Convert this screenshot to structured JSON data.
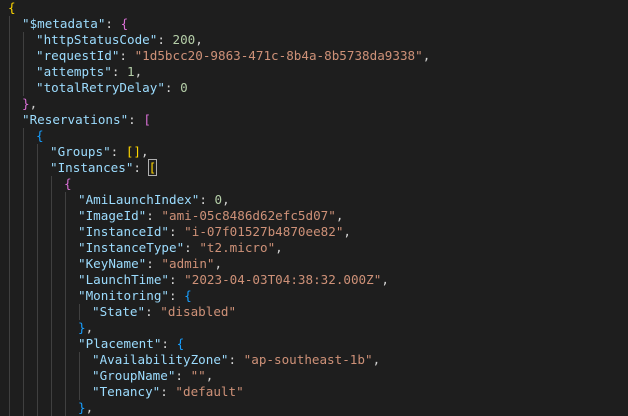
{
  "lines": [
    {
      "indent": 0,
      "tokens": [
        {
          "t": "{",
          "c": "b1"
        }
      ]
    },
    {
      "indent": 1,
      "tokens": [
        {
          "t": "\"$metadata\"",
          "c": "k"
        },
        {
          "t": ": ",
          "c": "p"
        },
        {
          "t": "{",
          "c": "b2"
        }
      ]
    },
    {
      "indent": 2,
      "tokens": [
        {
          "t": "\"httpStatusCode\"",
          "c": "k"
        },
        {
          "t": ": ",
          "c": "p"
        },
        {
          "t": "200",
          "c": "n"
        },
        {
          "t": ",",
          "c": "p"
        }
      ]
    },
    {
      "indent": 2,
      "tokens": [
        {
          "t": "\"requestId\"",
          "c": "k"
        },
        {
          "t": ": ",
          "c": "p"
        },
        {
          "t": "\"1d5bcc20-9863-471c-8b4a-8b5738da9338\"",
          "c": "s"
        },
        {
          "t": ",",
          "c": "p"
        }
      ]
    },
    {
      "indent": 2,
      "tokens": [
        {
          "t": "\"attempts\"",
          "c": "k"
        },
        {
          "t": ": ",
          "c": "p"
        },
        {
          "t": "1",
          "c": "n"
        },
        {
          "t": ",",
          "c": "p"
        }
      ]
    },
    {
      "indent": 2,
      "tokens": [
        {
          "t": "\"totalRetryDelay\"",
          "c": "k"
        },
        {
          "t": ": ",
          "c": "p"
        },
        {
          "t": "0",
          "c": "n"
        }
      ]
    },
    {
      "indent": 1,
      "tokens": [
        {
          "t": "}",
          "c": "b2"
        },
        {
          "t": ",",
          "c": "p"
        }
      ]
    },
    {
      "indent": 1,
      "tokens": [
        {
          "t": "\"Reservations\"",
          "c": "k"
        },
        {
          "t": ": ",
          "c": "p"
        },
        {
          "t": "[",
          "c": "b2"
        }
      ]
    },
    {
      "indent": 2,
      "tokens": [
        {
          "t": "{",
          "c": "b3"
        }
      ]
    },
    {
      "indent": 3,
      "tokens": [
        {
          "t": "\"Groups\"",
          "c": "k"
        },
        {
          "t": ": ",
          "c": "p"
        },
        {
          "t": "[]",
          "c": "b1"
        },
        {
          "t": ",",
          "c": "p"
        }
      ]
    },
    {
      "indent": 3,
      "tokens": [
        {
          "t": "\"Instances\"",
          "c": "k"
        },
        {
          "t": ": ",
          "c": "p"
        },
        {
          "t": "[",
          "c": "b1",
          "match": true
        },
        {
          "t": "",
          "c": "cursor"
        }
      ]
    },
    {
      "indent": 4,
      "tokens": [
        {
          "t": "{",
          "c": "b2"
        }
      ]
    },
    {
      "indent": 5,
      "tokens": [
        {
          "t": "\"AmiLaunchIndex\"",
          "c": "k"
        },
        {
          "t": ": ",
          "c": "p"
        },
        {
          "t": "0",
          "c": "n"
        },
        {
          "t": ",",
          "c": "p"
        }
      ]
    },
    {
      "indent": 5,
      "tokens": [
        {
          "t": "\"ImageId\"",
          "c": "k"
        },
        {
          "t": ": ",
          "c": "p"
        },
        {
          "t": "\"ami-05c8486d62efc5d07\"",
          "c": "s"
        },
        {
          "t": ",",
          "c": "p"
        }
      ]
    },
    {
      "indent": 5,
      "tokens": [
        {
          "t": "\"InstanceId\"",
          "c": "k"
        },
        {
          "t": ": ",
          "c": "p"
        },
        {
          "t": "\"i-07f01527b4870ee82\"",
          "c": "s"
        },
        {
          "t": ",",
          "c": "p"
        }
      ]
    },
    {
      "indent": 5,
      "tokens": [
        {
          "t": "\"InstanceType\"",
          "c": "k"
        },
        {
          "t": ": ",
          "c": "p"
        },
        {
          "t": "\"t2.micro\"",
          "c": "s"
        },
        {
          "t": ",",
          "c": "p"
        }
      ]
    },
    {
      "indent": 5,
      "tokens": [
        {
          "t": "\"KeyName\"",
          "c": "k"
        },
        {
          "t": ": ",
          "c": "p"
        },
        {
          "t": "\"admin\"",
          "c": "s"
        },
        {
          "t": ",",
          "c": "p"
        }
      ]
    },
    {
      "indent": 5,
      "tokens": [
        {
          "t": "\"LaunchTime\"",
          "c": "k"
        },
        {
          "t": ": ",
          "c": "p"
        },
        {
          "t": "\"2023-04-03T04:38:32.000Z\"",
          "c": "s"
        },
        {
          "t": ",",
          "c": "p"
        }
      ]
    },
    {
      "indent": 5,
      "tokens": [
        {
          "t": "\"Monitoring\"",
          "c": "k"
        },
        {
          "t": ": ",
          "c": "p"
        },
        {
          "t": "{",
          "c": "b3"
        }
      ]
    },
    {
      "indent": 6,
      "tokens": [
        {
          "t": "\"State\"",
          "c": "k"
        },
        {
          "t": ": ",
          "c": "p"
        },
        {
          "t": "\"disabled\"",
          "c": "s"
        }
      ]
    },
    {
      "indent": 5,
      "tokens": [
        {
          "t": "}",
          "c": "b3"
        },
        {
          "t": ",",
          "c": "p"
        }
      ]
    },
    {
      "indent": 5,
      "tokens": [
        {
          "t": "\"Placement\"",
          "c": "k"
        },
        {
          "t": ": ",
          "c": "p"
        },
        {
          "t": "{",
          "c": "b3"
        }
      ]
    },
    {
      "indent": 6,
      "tokens": [
        {
          "t": "\"AvailabilityZone\"",
          "c": "k"
        },
        {
          "t": ": ",
          "c": "p"
        },
        {
          "t": "\"ap-southeast-1b\"",
          "c": "s"
        },
        {
          "t": ",",
          "c": "p"
        }
      ]
    },
    {
      "indent": 6,
      "tokens": [
        {
          "t": "\"GroupName\"",
          "c": "k"
        },
        {
          "t": ": ",
          "c": "p"
        },
        {
          "t": "\"\"",
          "c": "s"
        },
        {
          "t": ",",
          "c": "p"
        }
      ]
    },
    {
      "indent": 6,
      "tokens": [
        {
          "t": "\"Tenancy\"",
          "c": "k"
        },
        {
          "t": ": ",
          "c": "p"
        },
        {
          "t": "\"default\"",
          "c": "s"
        }
      ]
    },
    {
      "indent": 5,
      "tokens": [
        {
          "t": "}",
          "c": "b3"
        },
        {
          "t": ",",
          "c": "p"
        }
      ]
    }
  ]
}
